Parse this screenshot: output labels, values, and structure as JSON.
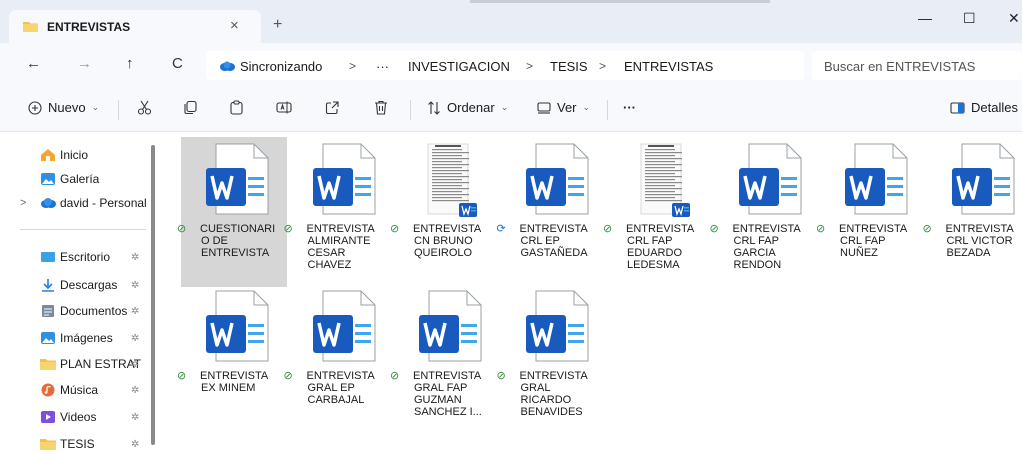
{
  "window": {
    "tab_title": "ENTREVISTAS",
    "tab_close": "×",
    "new_tab": "+",
    "minimize": "—",
    "maximize": "☐",
    "close": "✕"
  },
  "address": {
    "back": "←",
    "forward": "→",
    "up": "↑",
    "refresh": "C",
    "breadcrumbs": [
      "Sincronizando",
      "···",
      "INVESTIGACION",
      "TESIS",
      "ENTREVISTAS"
    ],
    "separator": ">",
    "search_placeholder": "Buscar en ENTREVISTAS"
  },
  "toolbar": {
    "new_label": "Nuevo",
    "sort_label": "Ordenar",
    "view_label": "Ver",
    "more_label": "···",
    "details_label": "Detalles",
    "caret": "⌄"
  },
  "sidebar": {
    "items": [
      {
        "label": "Inicio",
        "icon": "home-icon",
        "color": "#f0a830"
      },
      {
        "label": "Galería",
        "icon": "gallery-icon",
        "color": "#2f8fe0"
      },
      {
        "label": "david - Personal",
        "icon": "onedrive-icon",
        "color": "#1a73d6"
      },
      {
        "label": "Escritorio",
        "icon": "desktop-icon",
        "color": "#3aa0e8"
      },
      {
        "label": "Descargas",
        "icon": "download-icon",
        "color": "#2a7de1"
      },
      {
        "label": "Documentos",
        "icon": "documents-icon",
        "color": "#7a8aa0"
      },
      {
        "label": "Imágenes",
        "icon": "images-icon",
        "color": "#2f8fe0"
      },
      {
        "label": "PLAN ESTRAT",
        "icon": "folder-icon",
        "color": "#f3c444"
      },
      {
        "label": "Música",
        "icon": "music-icon",
        "color": "#e56b3c"
      },
      {
        "label": "Videos",
        "icon": "videos-icon",
        "color": "#7d4ee0"
      },
      {
        "label": "TESIS",
        "icon": "folder-icon",
        "color": "#f3c444"
      }
    ],
    "expander": ">",
    "pin": "✲"
  },
  "files": [
    {
      "lines": [
        "CUESTIONARI",
        "O DE",
        "ENTREVISTA"
      ],
      "status": "synced",
      "thumb": "word"
    },
    {
      "lines": [
        "ENTREVISTA",
        "ALMIRANTE",
        "CESAR",
        "CHAVEZ"
      ],
      "status": "synced",
      "thumb": "word"
    },
    {
      "lines": [
        "ENTREVISTA",
        "CN BRUNO",
        "QUEIROLO"
      ],
      "status": "synced",
      "thumb": "preview"
    },
    {
      "lines": [
        "ENTREVISTA",
        "CRL EP",
        "GASTAÑEDA"
      ],
      "status": "syncing",
      "thumb": "word"
    },
    {
      "lines": [
        "ENTREVISTA",
        "CRL FAP",
        "EDUARDO",
        "LEDESMA"
      ],
      "status": "synced",
      "thumb": "preview"
    },
    {
      "lines": [
        "ENTREVISTA",
        "CRL FAP",
        "GARCIA",
        "RENDON"
      ],
      "status": "synced",
      "thumb": "word"
    },
    {
      "lines": [
        "ENTREVISTA",
        "CRL FAP",
        "NUÑEZ"
      ],
      "status": "synced",
      "thumb": "word"
    },
    {
      "lines": [
        "ENTREVISTA",
        "CRL VICTOR",
        "BEZADA"
      ],
      "status": "synced",
      "thumb": "word"
    },
    {
      "lines": [
        "ENTREVISTA",
        "EX MINEM"
      ],
      "status": "synced",
      "thumb": "word"
    },
    {
      "lines": [
        "ENTREVISTA",
        "GRAL EP",
        "CARBAJAL"
      ],
      "status": "synced",
      "thumb": "word"
    },
    {
      "lines": [
        "ENTREVISTA",
        "GRAL FAP",
        "GUZMAN",
        "SANCHEZ I..."
      ],
      "status": "synced",
      "thumb": "word"
    },
    {
      "lines": [
        "ENTREVISTA",
        "GRAL",
        "RICARDO",
        "BENAVIDES"
      ],
      "status": "synced",
      "thumb": "word"
    }
  ],
  "status_glyphs": {
    "synced": "⊘",
    "syncing": "⟳"
  },
  "colors": {
    "word_blue": "#185abd",
    "word_light": "#41a5ee",
    "accent": "#1a73d6",
    "synced_green": "#2e8b3a"
  }
}
